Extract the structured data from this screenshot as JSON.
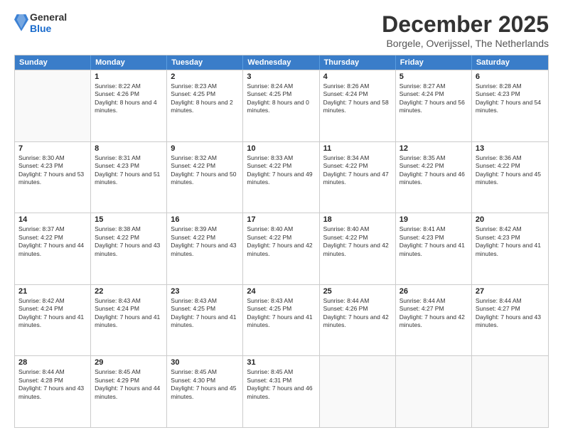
{
  "logo": {
    "general": "General",
    "blue": "Blue"
  },
  "header": {
    "title": "December 2025",
    "subtitle": "Borgele, Overijssel, The Netherlands"
  },
  "days": [
    "Sunday",
    "Monday",
    "Tuesday",
    "Wednesday",
    "Thursday",
    "Friday",
    "Saturday"
  ],
  "weeks": [
    [
      {
        "date": "",
        "sunrise": "",
        "sunset": "",
        "daylight": ""
      },
      {
        "date": "1",
        "sunrise": "Sunrise: 8:22 AM",
        "sunset": "Sunset: 4:26 PM",
        "daylight": "Daylight: 8 hours and 4 minutes."
      },
      {
        "date": "2",
        "sunrise": "Sunrise: 8:23 AM",
        "sunset": "Sunset: 4:25 PM",
        "daylight": "Daylight: 8 hours and 2 minutes."
      },
      {
        "date": "3",
        "sunrise": "Sunrise: 8:24 AM",
        "sunset": "Sunset: 4:25 PM",
        "daylight": "Daylight: 8 hours and 0 minutes."
      },
      {
        "date": "4",
        "sunrise": "Sunrise: 8:26 AM",
        "sunset": "Sunset: 4:24 PM",
        "daylight": "Daylight: 7 hours and 58 minutes."
      },
      {
        "date": "5",
        "sunrise": "Sunrise: 8:27 AM",
        "sunset": "Sunset: 4:24 PM",
        "daylight": "Daylight: 7 hours and 56 minutes."
      },
      {
        "date": "6",
        "sunrise": "Sunrise: 8:28 AM",
        "sunset": "Sunset: 4:23 PM",
        "daylight": "Daylight: 7 hours and 54 minutes."
      }
    ],
    [
      {
        "date": "7",
        "sunrise": "Sunrise: 8:30 AM",
        "sunset": "Sunset: 4:23 PM",
        "daylight": "Daylight: 7 hours and 53 minutes."
      },
      {
        "date": "8",
        "sunrise": "Sunrise: 8:31 AM",
        "sunset": "Sunset: 4:23 PM",
        "daylight": "Daylight: 7 hours and 51 minutes."
      },
      {
        "date": "9",
        "sunrise": "Sunrise: 8:32 AM",
        "sunset": "Sunset: 4:22 PM",
        "daylight": "Daylight: 7 hours and 50 minutes."
      },
      {
        "date": "10",
        "sunrise": "Sunrise: 8:33 AM",
        "sunset": "Sunset: 4:22 PM",
        "daylight": "Daylight: 7 hours and 49 minutes."
      },
      {
        "date": "11",
        "sunrise": "Sunrise: 8:34 AM",
        "sunset": "Sunset: 4:22 PM",
        "daylight": "Daylight: 7 hours and 47 minutes."
      },
      {
        "date": "12",
        "sunrise": "Sunrise: 8:35 AM",
        "sunset": "Sunset: 4:22 PM",
        "daylight": "Daylight: 7 hours and 46 minutes."
      },
      {
        "date": "13",
        "sunrise": "Sunrise: 8:36 AM",
        "sunset": "Sunset: 4:22 PM",
        "daylight": "Daylight: 7 hours and 45 minutes."
      }
    ],
    [
      {
        "date": "14",
        "sunrise": "Sunrise: 8:37 AM",
        "sunset": "Sunset: 4:22 PM",
        "daylight": "Daylight: 7 hours and 44 minutes."
      },
      {
        "date": "15",
        "sunrise": "Sunrise: 8:38 AM",
        "sunset": "Sunset: 4:22 PM",
        "daylight": "Daylight: 7 hours and 43 minutes."
      },
      {
        "date": "16",
        "sunrise": "Sunrise: 8:39 AM",
        "sunset": "Sunset: 4:22 PM",
        "daylight": "Daylight: 7 hours and 43 minutes."
      },
      {
        "date": "17",
        "sunrise": "Sunrise: 8:40 AM",
        "sunset": "Sunset: 4:22 PM",
        "daylight": "Daylight: 7 hours and 42 minutes."
      },
      {
        "date": "18",
        "sunrise": "Sunrise: 8:40 AM",
        "sunset": "Sunset: 4:22 PM",
        "daylight": "Daylight: 7 hours and 42 minutes."
      },
      {
        "date": "19",
        "sunrise": "Sunrise: 8:41 AM",
        "sunset": "Sunset: 4:23 PM",
        "daylight": "Daylight: 7 hours and 41 minutes."
      },
      {
        "date": "20",
        "sunrise": "Sunrise: 8:42 AM",
        "sunset": "Sunset: 4:23 PM",
        "daylight": "Daylight: 7 hours and 41 minutes."
      }
    ],
    [
      {
        "date": "21",
        "sunrise": "Sunrise: 8:42 AM",
        "sunset": "Sunset: 4:24 PM",
        "daylight": "Daylight: 7 hours and 41 minutes."
      },
      {
        "date": "22",
        "sunrise": "Sunrise: 8:43 AM",
        "sunset": "Sunset: 4:24 PM",
        "daylight": "Daylight: 7 hours and 41 minutes."
      },
      {
        "date": "23",
        "sunrise": "Sunrise: 8:43 AM",
        "sunset": "Sunset: 4:25 PM",
        "daylight": "Daylight: 7 hours and 41 minutes."
      },
      {
        "date": "24",
        "sunrise": "Sunrise: 8:43 AM",
        "sunset": "Sunset: 4:25 PM",
        "daylight": "Daylight: 7 hours and 41 minutes."
      },
      {
        "date": "25",
        "sunrise": "Sunrise: 8:44 AM",
        "sunset": "Sunset: 4:26 PM",
        "daylight": "Daylight: 7 hours and 42 minutes."
      },
      {
        "date": "26",
        "sunrise": "Sunrise: 8:44 AM",
        "sunset": "Sunset: 4:27 PM",
        "daylight": "Daylight: 7 hours and 42 minutes."
      },
      {
        "date": "27",
        "sunrise": "Sunrise: 8:44 AM",
        "sunset": "Sunset: 4:27 PM",
        "daylight": "Daylight: 7 hours and 43 minutes."
      }
    ],
    [
      {
        "date": "28",
        "sunrise": "Sunrise: 8:44 AM",
        "sunset": "Sunset: 4:28 PM",
        "daylight": "Daylight: 7 hours and 43 minutes."
      },
      {
        "date": "29",
        "sunrise": "Sunrise: 8:45 AM",
        "sunset": "Sunset: 4:29 PM",
        "daylight": "Daylight: 7 hours and 44 minutes."
      },
      {
        "date": "30",
        "sunrise": "Sunrise: 8:45 AM",
        "sunset": "Sunset: 4:30 PM",
        "daylight": "Daylight: 7 hours and 45 minutes."
      },
      {
        "date": "31",
        "sunrise": "Sunrise: 8:45 AM",
        "sunset": "Sunset: 4:31 PM",
        "daylight": "Daylight: 7 hours and 46 minutes."
      },
      {
        "date": "",
        "sunrise": "",
        "sunset": "",
        "daylight": ""
      },
      {
        "date": "",
        "sunrise": "",
        "sunset": "",
        "daylight": ""
      },
      {
        "date": "",
        "sunrise": "",
        "sunset": "",
        "daylight": ""
      }
    ]
  ]
}
